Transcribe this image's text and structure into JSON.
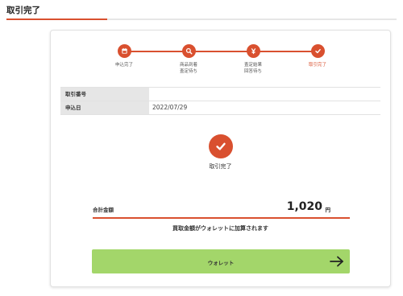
{
  "page": {
    "title": "取引完了"
  },
  "colors": {
    "accent": "#d9502f",
    "button": "#a3d66a",
    "table_header_bg": "#e6e6e6"
  },
  "steps": [
    {
      "label": "申込完了",
      "icon": "calendar-icon"
    },
    {
      "label": "商品到着\n査定待ち",
      "icon": "search-icon"
    },
    {
      "label": "査定結果\n回答待ち",
      "icon": "yen-icon"
    },
    {
      "label": "取引完了",
      "icon": "check-icon",
      "active": true
    }
  ],
  "info": [
    {
      "label": "取引番号",
      "value": ""
    },
    {
      "label": "申込日",
      "value": "2022/07/29"
    }
  ],
  "status": {
    "label": "取引完了",
    "icon": "check-icon"
  },
  "total": {
    "label": "合計金額",
    "amount": "1,020",
    "unit": "円"
  },
  "notice": "買取金額がウォレットに加算されます",
  "wallet_button": {
    "label": "ウォレット",
    "icon": "arrow-right-icon"
  }
}
